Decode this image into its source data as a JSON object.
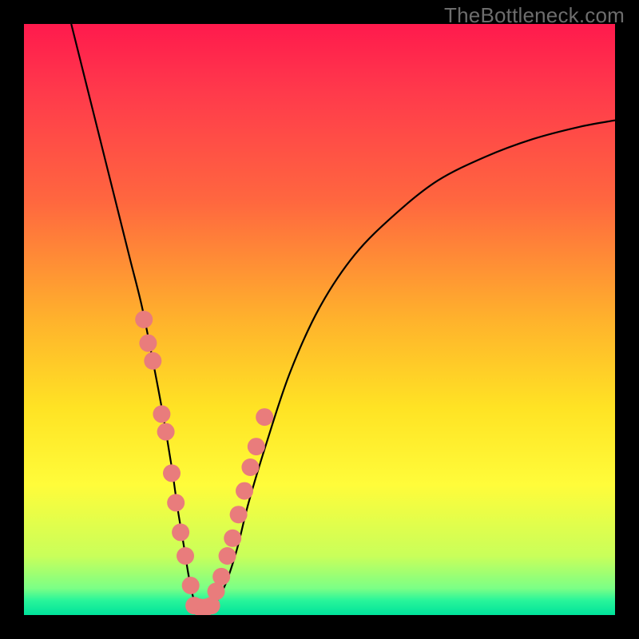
{
  "watermark": "TheBottleneck.com",
  "chart_data": {
    "type": "line",
    "title": "",
    "xlabel": "",
    "ylabel": "",
    "xlim": [
      0,
      100
    ],
    "ylim": [
      0,
      100
    ],
    "grid": false,
    "legend": false,
    "background_gradient": {
      "stops": [
        {
          "offset": 0.0,
          "color": "#ff1a4d"
        },
        {
          "offset": 0.12,
          "color": "#ff3b4b"
        },
        {
          "offset": 0.3,
          "color": "#ff673f"
        },
        {
          "offset": 0.5,
          "color": "#ffb22c"
        },
        {
          "offset": 0.65,
          "color": "#ffe324"
        },
        {
          "offset": 0.78,
          "color": "#fffc3a"
        },
        {
          "offset": 0.9,
          "color": "#c9ff5a"
        },
        {
          "offset": 0.955,
          "color": "#7bff86"
        },
        {
          "offset": 0.975,
          "color": "#29f59a"
        },
        {
          "offset": 1.0,
          "color": "#00e39b"
        }
      ]
    },
    "series": [
      {
        "name": "curve",
        "type": "line",
        "color": "#000000",
        "width": 2.2,
        "x": [
          8,
          10,
          12,
          14,
          16,
          18,
          20,
          22,
          23.5,
          25,
          26,
          27,
          27.8,
          28.5,
          29.2,
          30,
          31,
          32,
          34,
          36,
          38,
          41,
          45,
          50,
          56,
          63,
          70,
          78,
          86,
          94,
          100
        ],
        "y": [
          100,
          92,
          84,
          76,
          68,
          60,
          52,
          42,
          34,
          25,
          18,
          12,
          7,
          3.5,
          1.4,
          0.4,
          0.4,
          1.4,
          5,
          11,
          19,
          29,
          41,
          52,
          61,
          68,
          73.5,
          77.5,
          80.5,
          82.6,
          83.7
        ]
      },
      {
        "name": "left-dots",
        "type": "scatter",
        "color": "#e97c7c",
        "radius": 11,
        "x": [
          20.3,
          21.0,
          21.8,
          23.3,
          24.0,
          25.0,
          25.7,
          26.5,
          27.3,
          28.2
        ],
        "y": [
          50.0,
          46.0,
          43.0,
          34.0,
          31.0,
          24.0,
          19.0,
          14.0,
          10.0,
          5.0
        ]
      },
      {
        "name": "right-dots",
        "type": "scatter",
        "color": "#e97c7c",
        "radius": 11,
        "x": [
          32.5,
          33.4,
          34.4,
          35.3,
          36.3,
          37.3,
          38.3,
          39.3,
          40.7
        ],
        "y": [
          4.0,
          6.5,
          10.0,
          13.0,
          17.0,
          21.0,
          25.0,
          28.5,
          33.5
        ]
      },
      {
        "name": "bottom-dots",
        "type": "scatter",
        "color": "#e97c7c",
        "radius": 11,
        "x": [
          28.8,
          29.8,
          30.8,
          31.7
        ],
        "y": [
          1.6,
          1.3,
          1.3,
          1.6
        ]
      }
    ]
  }
}
